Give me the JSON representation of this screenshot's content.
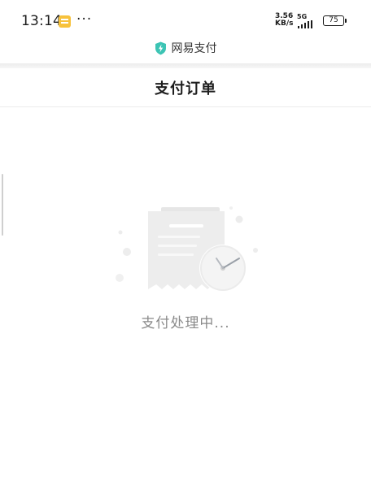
{
  "status_bar": {
    "time": "13:14",
    "more": "···",
    "net_speed_value": "3.56",
    "net_speed_unit": "KB/s",
    "network_type": "5G",
    "battery": "75",
    "icons": [
      "notification-app-icon",
      "signal-icon",
      "battery-icon"
    ]
  },
  "brand": {
    "name": "网易支付",
    "icon": "shield-lightning-icon",
    "accent_color": "#3cc4b4"
  },
  "header": {
    "title": "支付订单"
  },
  "main": {
    "illustration": "receipt-clock-icon",
    "status_text": "支付处理中..."
  }
}
